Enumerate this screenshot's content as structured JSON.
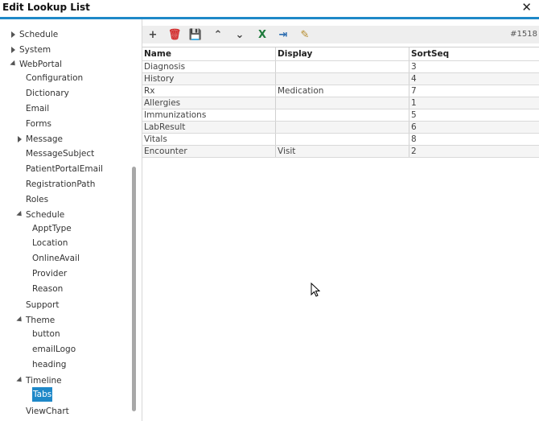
{
  "window": {
    "title": "Edit Lookup List"
  },
  "tree": [
    {
      "label": "Schedule",
      "arrow": "right"
    },
    {
      "label": "System",
      "arrow": "right"
    },
    {
      "label": "WebPortal",
      "arrow": "down"
    },
    {
      "label": "Configuration",
      "arrow": ""
    },
    {
      "label": "Dictionary",
      "arrow": ""
    },
    {
      "label": "Email",
      "arrow": ""
    },
    {
      "label": "Forms",
      "arrow": ""
    },
    {
      "label": "Message",
      "arrow": "right"
    },
    {
      "label": "MessageSubject",
      "arrow": ""
    },
    {
      "label": "PatientPortalEmail",
      "arrow": ""
    },
    {
      "label": "RegistrationPath",
      "arrow": ""
    },
    {
      "label": "Roles",
      "arrow": ""
    },
    {
      "label": "Schedule",
      "arrow": "down"
    },
    {
      "label": "ApptType",
      "arrow": ""
    },
    {
      "label": "Location",
      "arrow": ""
    },
    {
      "label": "OnlineAvail",
      "arrow": ""
    },
    {
      "label": "Provider",
      "arrow": ""
    },
    {
      "label": "Reason",
      "arrow": ""
    },
    {
      "label": "Support",
      "arrow": ""
    },
    {
      "label": "Theme",
      "arrow": "down"
    },
    {
      "label": "button",
      "arrow": ""
    },
    {
      "label": "emailLogo",
      "arrow": ""
    },
    {
      "label": "heading",
      "arrow": ""
    },
    {
      "label": "Timeline",
      "arrow": "down"
    },
    {
      "label": "Tabs",
      "arrow": "",
      "selected": true
    },
    {
      "label": "ViewChart",
      "arrow": ""
    }
  ],
  "toolbar": {
    "buttons": [
      {
        "name": "add-icon",
        "glyph": "+",
        "color": "#444444"
      },
      {
        "name": "delete-icon",
        "glyph": "🗑",
        "color": "#d32f2f"
      },
      {
        "name": "save-icon",
        "glyph": "💾",
        "color": "#555555"
      },
      {
        "name": "move-up-icon",
        "glyph": "⌃",
        "color": "#444444"
      },
      {
        "name": "move-down-icon",
        "glyph": "⌄",
        "color": "#444444"
      },
      {
        "name": "excel-export-icon",
        "glyph": "X",
        "color": "#1d7a3a"
      },
      {
        "name": "import-icon",
        "glyph": "⇥",
        "color": "#2b6cb0"
      },
      {
        "name": "notes-icon",
        "glyph": "✎",
        "color": "#b58a2a"
      }
    ],
    "record_id": "#1518"
  },
  "grid": {
    "columns": [
      "Name",
      "Display",
      "SortSeq"
    ],
    "rows": [
      [
        "Diagnosis",
        "",
        "3"
      ],
      [
        "History",
        "",
        "4"
      ],
      [
        "Rx",
        "Medication",
        "7"
      ],
      [
        "Allergies",
        "",
        "1"
      ],
      [
        "Immunizations",
        "",
        "5"
      ],
      [
        "LabResult",
        "",
        "6"
      ],
      [
        "Vitals",
        "",
        "8"
      ],
      [
        "Encounter",
        "Visit",
        "2"
      ]
    ]
  },
  "colors": {
    "accent": "#1e88c8",
    "selected_bg": "#1e88c8",
    "toolbar_bg": "#eeeeee"
  }
}
